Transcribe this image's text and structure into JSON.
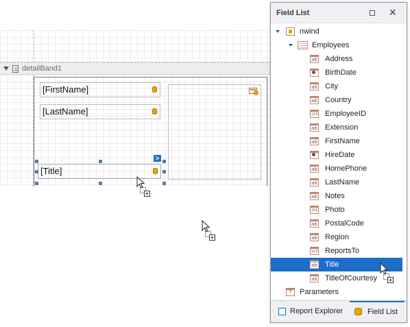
{
  "designer": {
    "band_label": "detailBand1",
    "fields": [
      {
        "text": "[FirstName]"
      },
      {
        "text": "[LastName]"
      },
      {
        "text": "[Title]"
      }
    ],
    "smart_tag_glyph": ">"
  },
  "field_list": {
    "title": "Field List",
    "maximize_glyph": "☐",
    "close_glyph": "✕",
    "tree": {
      "datasource": "nwind",
      "table": "Employees",
      "fields": [
        {
          "label": "Address",
          "icon": "text-field-icon"
        },
        {
          "label": "BirthDate",
          "icon": "date-field-icon"
        },
        {
          "label": "City",
          "icon": "text-field-icon"
        },
        {
          "label": "Country",
          "icon": "text-field-icon"
        },
        {
          "label": "EmployeeID",
          "icon": "number-field-icon"
        },
        {
          "label": "Extension",
          "icon": "text-field-icon"
        },
        {
          "label": "FirstName",
          "icon": "text-field-icon"
        },
        {
          "label": "HireDate",
          "icon": "date-field-icon"
        },
        {
          "label": "HomePhone",
          "icon": "text-field-icon"
        },
        {
          "label": "LastName",
          "icon": "text-field-icon"
        },
        {
          "label": "Notes",
          "icon": "text-field-icon"
        },
        {
          "label": "Photo",
          "icon": "binary-field-icon"
        },
        {
          "label": "PostalCode",
          "icon": "text-field-icon"
        },
        {
          "label": "Region",
          "icon": "text-field-icon"
        },
        {
          "label": "ReportsTo",
          "icon": "number-field-icon"
        },
        {
          "label": "Title",
          "icon": "text-field-icon",
          "selected": true
        },
        {
          "label": "TitleOfCourtesy",
          "icon": "text-field-icon"
        }
      ],
      "parameters": "Parameters"
    },
    "tabs": {
      "report_explorer": "Report Explorer",
      "field_list": "Field List"
    }
  },
  "colors": {
    "selection": "#1d6ec8",
    "tree_caret": "#1a5fb4",
    "db_icon": "#e8a700"
  }
}
